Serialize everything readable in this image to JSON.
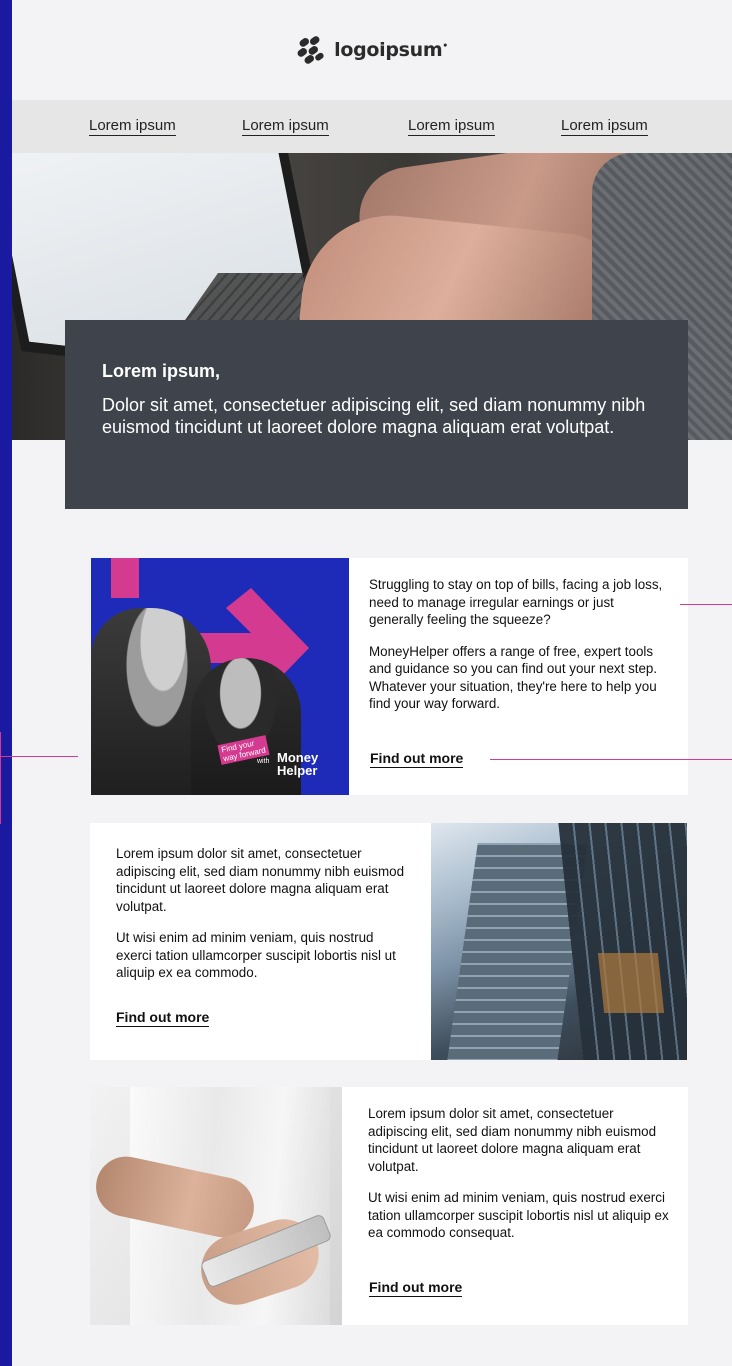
{
  "logo": {
    "text": "logoipsum",
    "mark": "logo-mark-icon"
  },
  "nav": {
    "items": [
      "Lorem ipsum",
      "Lorem ipsum",
      "Lorem ipsum",
      "Lorem ipsum"
    ]
  },
  "hero": {
    "title": "Lorem ipsum,",
    "text": "Dolor sit amet, consectetuer adipiscing elit, sed diam nonummy nibh euismod tincidunt ut laoreet dolore magna aliquam erat volutpat."
  },
  "card1": {
    "p1": "Struggling to stay on top of bills, facing a job loss, need to manage irregular earnings or just generally feeling the squeeze?",
    "p2": "MoneyHelper offers a range of free, expert tools and guidance so you can find out your next step. Whatever your situation, they're here to help you find your way forward.",
    "cta": "Find out more",
    "image": {
      "tag_line1": "Find your",
      "tag_line2": "way forward",
      "with": "with",
      "brand_line1": "Money",
      "brand_line2": "Helper"
    }
  },
  "card2": {
    "p1": "Lorem ipsum dolor sit amet, consectetuer adipiscing elit, sed diam nonummy nibh euismod tincidunt ut laoreet dolore magna aliquam erat volutpat.",
    "p2": "Ut wisi enim ad minim veniam, quis nostrud exerci tation ullamcorper suscipit lobortis nisl ut aliquip ex ea commodo.",
    "cta": "Find out more"
  },
  "card3": {
    "p1": "Lorem ipsum dolor sit amet, consectetuer adipiscing elit, sed diam nonummy nibh euismod tincidunt ut laoreet dolore magna aliquam erat volutpat.",
    "p2": "Ut wisi enim ad minim veniam, quis nostrud exerci tation ullamcorper suscipit lobortis nisl ut aliquip ex ea commodo consequat.",
    "cta": "Find out more"
  },
  "colors": {
    "frame": "#1a1aa0",
    "background": "#f3f3f6",
    "hero_box": "#3f444c",
    "accent": "#d43a8f"
  }
}
